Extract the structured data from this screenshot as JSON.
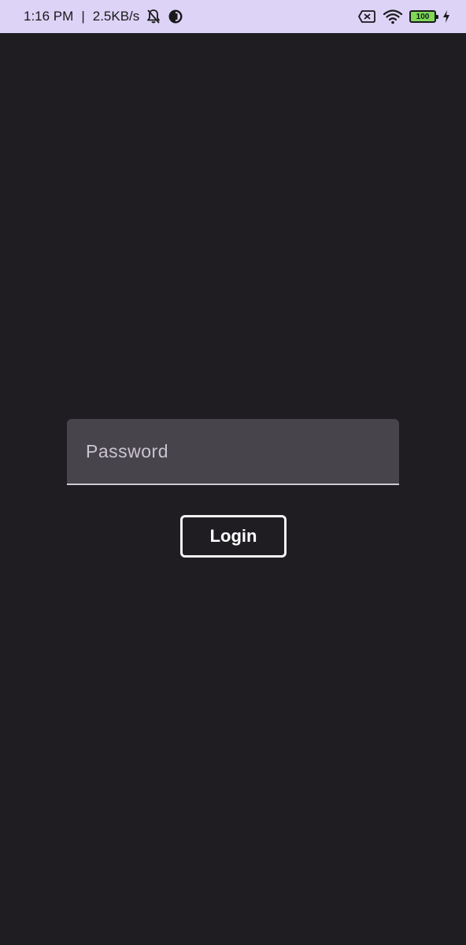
{
  "status_bar": {
    "time": "1:16 PM",
    "separator": "|",
    "network_speed": "2.5KB/s",
    "battery_level": "100",
    "icons": [
      "bell-off-icon",
      "app-notification-icon",
      "sim-off-icon",
      "wifi-icon",
      "battery-icon",
      "charging-icon"
    ],
    "background_color": "#dcd3f7"
  },
  "login_form": {
    "password_placeholder": "Password",
    "password_value": "",
    "login_label": "Login"
  },
  "colors": {
    "background": "#1f1d22",
    "field_background": "#47454b",
    "field_underline": "#cfcbd3",
    "button_border": "#f4f4f4"
  }
}
